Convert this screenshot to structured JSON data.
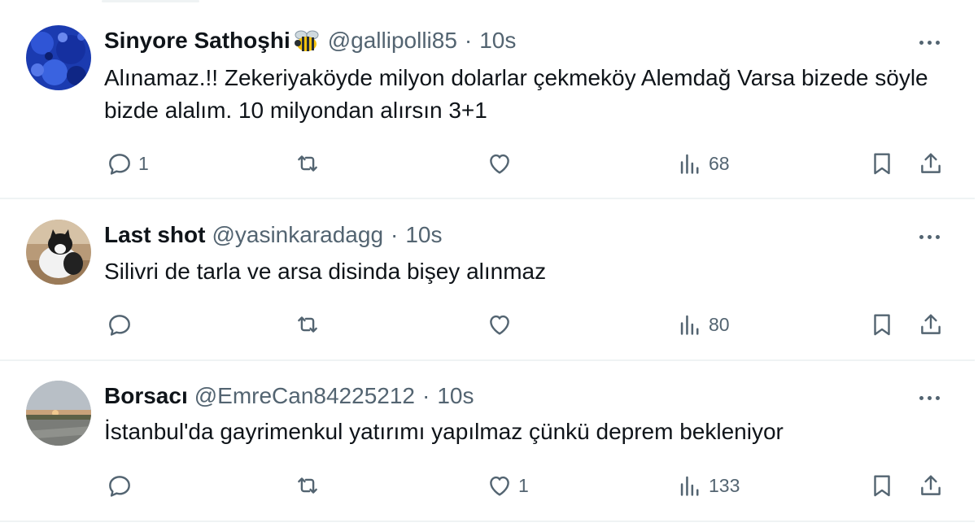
{
  "colors": {
    "text_primary": "#0f1419",
    "text_secondary": "#536471",
    "divider": "#eff3f4"
  },
  "tweets": [
    {
      "display_name": "Sinyore Sathoşhi",
      "badge_icon": "bee-emoji",
      "handle": "@gallipolli85",
      "separator": "·",
      "time": "10s",
      "text": "Alınamaz.!! Zekeriyaköyde milyon dolarlar çekmeköy Alemdağ Varsa bizede söyle bizde alalım. 10 milyondan alırsın 3+1",
      "replies": "1",
      "retweets": "",
      "likes": "",
      "views": "68"
    },
    {
      "display_name": "Last shot",
      "handle": "@yasinkaradagg",
      "separator": "·",
      "time": "10s",
      "text": "Silivri de tarla ve arsa disinda bişey alınmaz",
      "replies": "",
      "retweets": "",
      "likes": "",
      "views": "80"
    },
    {
      "display_name": "Borsacı",
      "handle": "@EmreCan84225212",
      "separator": "·",
      "time": "10s",
      "text": "İstanbul'da gayrimenkul yatırımı yapılmaz çünkü deprem bekleniyor",
      "replies": "",
      "retweets": "",
      "likes": "1",
      "views": "133"
    }
  ]
}
